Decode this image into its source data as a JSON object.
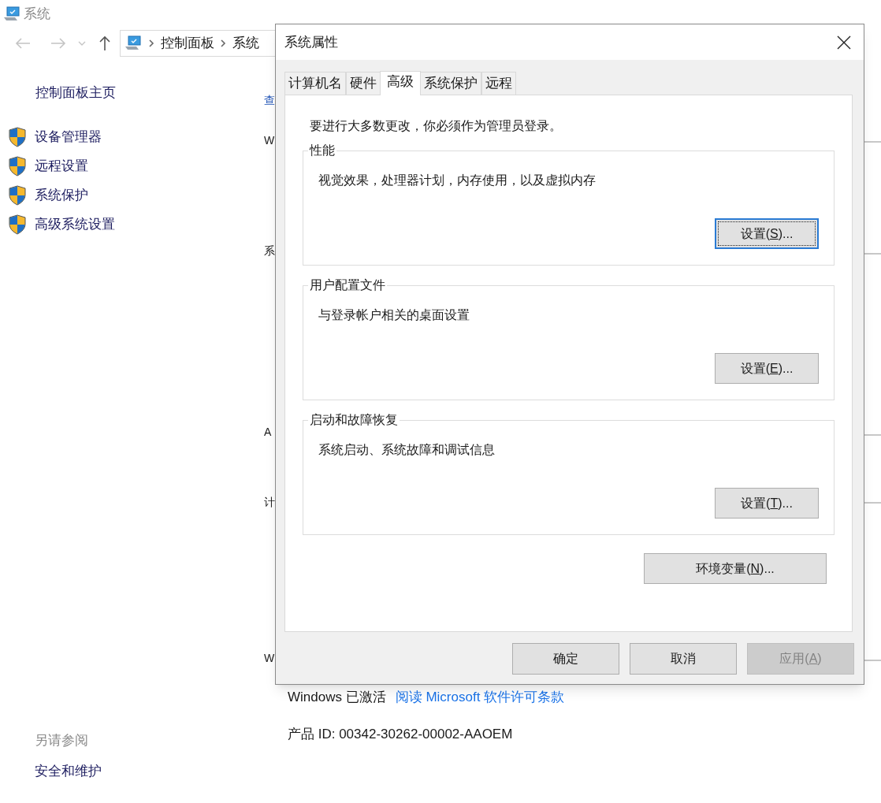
{
  "window": {
    "title": "系统"
  },
  "nav": {
    "address": [
      "控制面板",
      "系统"
    ]
  },
  "sidebar": {
    "home": "控制面板主页",
    "items": [
      "设备管理器",
      "远程设置",
      "系统保护",
      "高级系统设置"
    ],
    "see_also_title": "另请参阅",
    "see_also": [
      "安全和维护"
    ]
  },
  "main": {
    "clipped_lines": [
      {
        "text": "查",
        "kind": "link"
      },
      {
        "text": "W",
        "kind": "text"
      },
      {
        "text": "系",
        "kind": "text"
      },
      {
        "text": "A",
        "kind": "text"
      },
      {
        "text": "计",
        "kind": "text"
      },
      {
        "text": "W",
        "kind": "text"
      }
    ],
    "activation_status": "Windows 已激活",
    "license_link": "阅读 Microsoft 软件许可条款",
    "product_id": "产品 ID: 00342-30262-00002-AAOEM"
  },
  "dialog": {
    "title": "系统属性",
    "tabs": [
      {
        "label": "计算机名",
        "selected": false
      },
      {
        "label": "硬件",
        "selected": false
      },
      {
        "label": "高级",
        "selected": true
      },
      {
        "label": "系统保护",
        "selected": false
      },
      {
        "label": "远程",
        "selected": false
      }
    ],
    "notice": "要进行大多数更改，你必须作为管理员登录。",
    "groups": [
      {
        "title": "性能",
        "description": "视觉效果，处理器计划，内存使用，以及虚拟内存",
        "button": {
          "before": "设置(",
          "key": "S",
          "after": ")...",
          "focused": true
        }
      },
      {
        "title": "用户配置文件",
        "description": "与登录帐户相关的桌面设置",
        "button": {
          "before": "设置(",
          "key": "E",
          "after": ")...",
          "focused": false
        }
      },
      {
        "title": "启动和故障恢复",
        "description": "系统启动、系统故障和调试信息",
        "button": {
          "before": "设置(",
          "key": "T",
          "after": ")...",
          "focused": false
        }
      }
    ],
    "env_button": {
      "before": "环境变量(",
      "key": "N",
      "after": ")...",
      "focused": false
    },
    "buttons": [
      {
        "before": "确定",
        "disabled": false
      },
      {
        "before": "取消",
        "disabled": false
      },
      {
        "before": "应用(",
        "key": "A",
        "after": ")",
        "disabled": true
      }
    ]
  }
}
